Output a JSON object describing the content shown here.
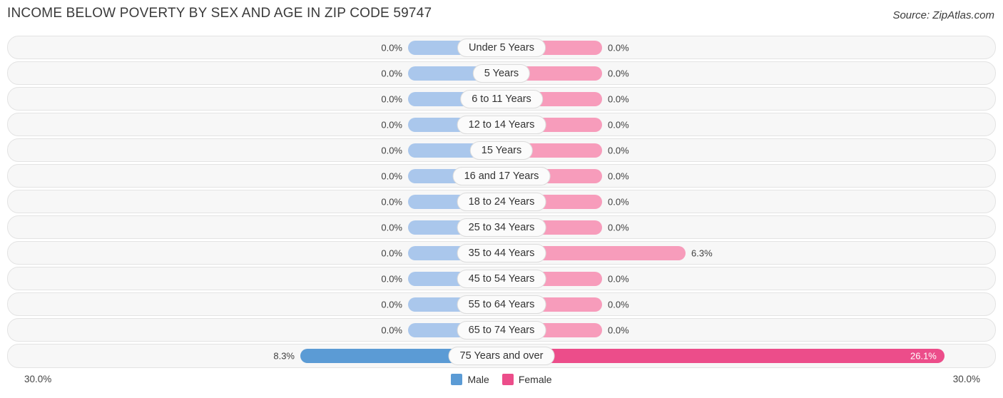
{
  "header": {
    "title": "Income Below Poverty by Sex and Age in Zip Code 59747",
    "source": "Source: ZipAtlas.com"
  },
  "axis": {
    "left_tick": "30.0%",
    "right_tick": "30.0%"
  },
  "legend": {
    "male": "Male",
    "female": "Female",
    "male_color": "#5b9bd5",
    "female_color": "#ec4d8a"
  },
  "chart_data": {
    "type": "bar",
    "title": "Income Below Poverty by Sex and Age in Zip Code 59747",
    "subtitle": "Source: ZipAtlas.com",
    "orientation": "horizontal-diverging",
    "xlabel": "",
    "ylabel": "",
    "xlim": [
      -30.0,
      30.0
    ],
    "axis_ticks": [
      "30.0%",
      "30.0%"
    ],
    "grid": false,
    "legend_position": "bottom-center",
    "categories": [
      "Under 5 Years",
      "5 Years",
      "6 to 11 Years",
      "12 to 14 Years",
      "15 Years",
      "16 and 17 Years",
      "18 to 24 Years",
      "25 to 34 Years",
      "35 to 44 Years",
      "45 to 54 Years",
      "55 to 64 Years",
      "65 to 74 Years",
      "75 Years and over"
    ],
    "series": [
      {
        "name": "Male",
        "color": "#5b9bd5",
        "values": [
          0.0,
          0.0,
          0.0,
          0.0,
          0.0,
          0.0,
          0.0,
          0.0,
          0.0,
          0.0,
          0.0,
          0.0,
          8.3
        ],
        "labels": [
          "0.0%",
          "0.0%",
          "0.0%",
          "0.0%",
          "0.0%",
          "0.0%",
          "0.0%",
          "0.0%",
          "0.0%",
          "0.0%",
          "0.0%",
          "0.0%",
          "8.3%"
        ]
      },
      {
        "name": "Female",
        "color": "#ec4d8a",
        "values": [
          0.0,
          0.0,
          0.0,
          0.0,
          0.0,
          0.0,
          0.0,
          0.0,
          6.3,
          0.0,
          0.0,
          0.0,
          26.1
        ],
        "labels": [
          "0.0%",
          "0.0%",
          "0.0%",
          "0.0%",
          "0.0%",
          "0.0%",
          "0.0%",
          "0.0%",
          "6.3%",
          "0.0%",
          "0.0%",
          "0.0%",
          "26.1%"
        ]
      }
    ]
  },
  "rows": [
    {
      "label": "Under 5 Years",
      "male": "0.0%",
      "female": "0.0%",
      "male_w": 130,
      "female_w": 140,
      "male_strong": false,
      "female_strong": false,
      "female_inside": false
    },
    {
      "label": "5 Years",
      "male": "0.0%",
      "female": "0.0%",
      "male_w": 130,
      "female_w": 140,
      "male_strong": false,
      "female_strong": false,
      "female_inside": false
    },
    {
      "label": "6 to 11 Years",
      "male": "0.0%",
      "female": "0.0%",
      "male_w": 130,
      "female_w": 140,
      "male_strong": false,
      "female_strong": false,
      "female_inside": false
    },
    {
      "label": "12 to 14 Years",
      "male": "0.0%",
      "female": "0.0%",
      "male_w": 130,
      "female_w": 140,
      "male_strong": false,
      "female_strong": false,
      "female_inside": false
    },
    {
      "label": "15 Years",
      "male": "0.0%",
      "female": "0.0%",
      "male_w": 130,
      "female_w": 140,
      "male_strong": false,
      "female_strong": false,
      "female_inside": false
    },
    {
      "label": "16 and 17 Years",
      "male": "0.0%",
      "female": "0.0%",
      "male_w": 130,
      "female_w": 140,
      "male_strong": false,
      "female_strong": false,
      "female_inside": false
    },
    {
      "label": "18 to 24 Years",
      "male": "0.0%",
      "female": "0.0%",
      "male_w": 130,
      "female_w": 140,
      "male_strong": false,
      "female_strong": false,
      "female_inside": false
    },
    {
      "label": "25 to 34 Years",
      "male": "0.0%",
      "female": "0.0%",
      "male_w": 130,
      "female_w": 140,
      "male_strong": false,
      "female_strong": false,
      "female_inside": false
    },
    {
      "label": "35 to 44 Years",
      "male": "0.0%",
      "female": "6.3%",
      "male_w": 130,
      "female_w": 257,
      "male_strong": false,
      "female_strong": false,
      "female_inside": false
    },
    {
      "label": "45 to 54 Years",
      "male": "0.0%",
      "female": "0.0%",
      "male_w": 130,
      "female_w": 140,
      "male_strong": false,
      "female_strong": false,
      "female_inside": false
    },
    {
      "label": "55 to 64 Years",
      "male": "0.0%",
      "female": "0.0%",
      "male_w": 130,
      "female_w": 140,
      "male_strong": false,
      "female_strong": false,
      "female_inside": false
    },
    {
      "label": "65 to 74 Years",
      "male": "0.0%",
      "female": "0.0%",
      "male_w": 130,
      "female_w": 140,
      "male_strong": false,
      "female_strong": false,
      "female_inside": false
    },
    {
      "label": "75 Years and over",
      "male": "8.3%",
      "female": "26.1%",
      "male_w": 281,
      "female_w": 620,
      "male_strong": true,
      "female_strong": true,
      "female_inside": true
    }
  ]
}
